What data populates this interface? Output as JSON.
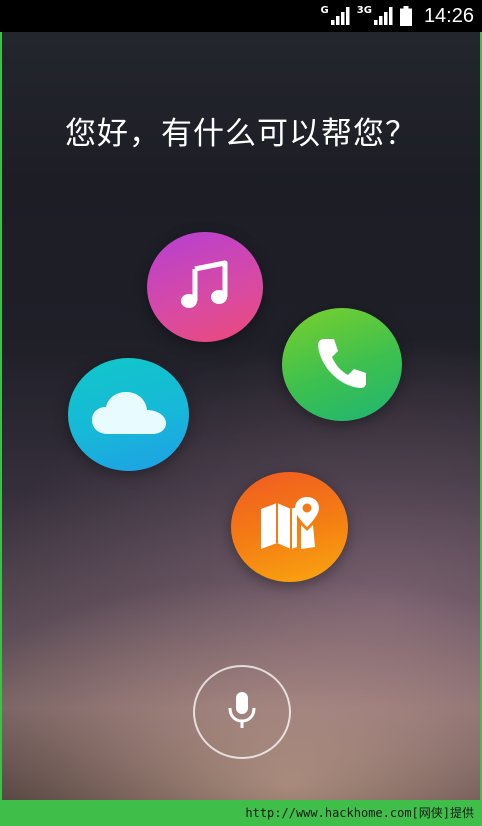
{
  "status_bar": {
    "network_primary": "G",
    "network_secondary": "3G",
    "time": "14:26"
  },
  "assistant": {
    "greeting": "您好，有什么可以帮您？"
  },
  "shortcuts": [
    {
      "name": "music",
      "icon": "music-note-icon"
    },
    {
      "name": "phone",
      "icon": "phone-icon"
    },
    {
      "name": "cloud",
      "icon": "cloud-icon"
    },
    {
      "name": "map",
      "icon": "map-pin-icon"
    }
  ],
  "voice": {
    "icon": "microphone-icon"
  },
  "watermark": {
    "text": "http://www.hackhome.com[网侠]提供"
  },
  "colors": {
    "frame_green": "#3fbf4a",
    "music_gradient": [
      "#b53fd3",
      "#ec4a7a"
    ],
    "phone_gradient": [
      "#7bd02c",
      "#1fb574"
    ],
    "cloud_gradient": [
      "#10c8c8",
      "#1e9fe6"
    ],
    "map_gradient": [
      "#f05a22",
      "#f9a70f"
    ]
  }
}
